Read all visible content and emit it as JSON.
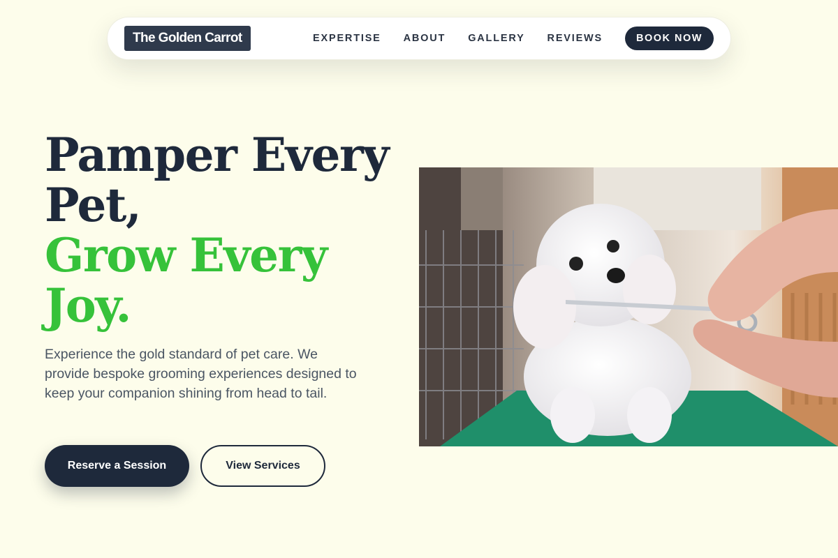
{
  "brand": {
    "name": "The Golden Carrot"
  },
  "nav": {
    "links": [
      "EXPERTISE",
      "ABOUT",
      "GALLERY",
      "REVIEWS"
    ],
    "cta": "BOOK NOW"
  },
  "hero": {
    "title_line1": "Pamper Every",
    "title_line2": "Pet,",
    "title_line3": "Grow Every",
    "title_line4": "Joy.",
    "description": "Experience the gold standard of pet care. We provide bespoke grooming experiences designed to keep your companion shining from head to tail.",
    "primary_button": "Reserve a Session",
    "secondary_button": "View Services",
    "image_alt": "Groomer trimming a white poodle with scissors"
  },
  "colors": {
    "background": "#fdfdeb",
    "navy": "#1e293b",
    "accent_green": "#36c23a",
    "logo_bg": "#2f3a4c"
  }
}
